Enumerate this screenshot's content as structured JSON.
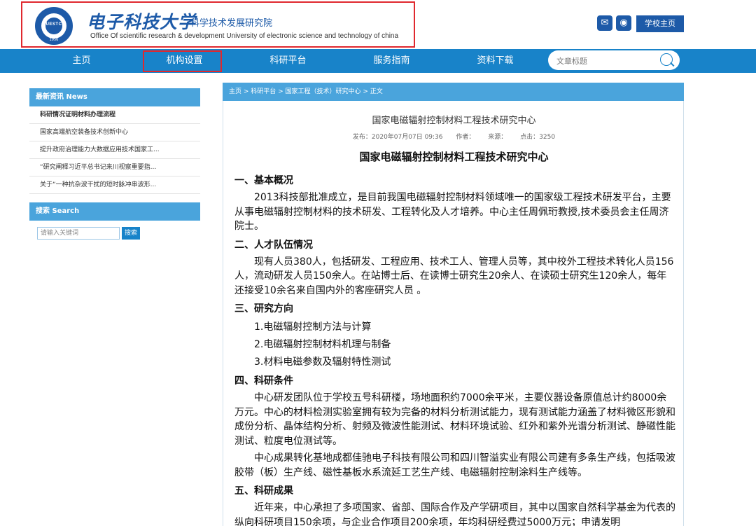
{
  "header": {
    "seal_text": "UESTC",
    "seal_year": "1956",
    "university_name": "电子科技大学",
    "institute_name": "科学技术发展研究院",
    "english_name": "Office Of scientific research & development University of electronic science and technology of china",
    "wechat_icon": "wechat-icon",
    "weibo_icon": "weibo-icon",
    "school_home_label": "学校主页"
  },
  "nav": {
    "items": [
      "主页",
      "机构设置",
      "科研平台",
      "服务指南",
      "资料下载"
    ],
    "search_placeholder": "文章标题"
  },
  "sidebar": {
    "news_header": "最新资讯   News",
    "news_items": [
      "科研情况证明材料办理流程",
      "国家高端航空装备技术创新中心",
      "提升政府治理能力大数据应用技术国家工...",
      "“研究阐释习近平总书记来川视察重要指...",
      "关于“一种抗杂波干扰的短时脉冲串波形..."
    ],
    "search_header": "搜索   Search",
    "search_placeholder": "请输入关键词",
    "search_button": "搜索"
  },
  "breadcrumb": "主页 > 科研平台 > 国家工程（技术）研究中心 > 正文",
  "article": {
    "title": "国家电磁辐射控制材料工程技术研究中心",
    "publish": "发布：2020年07月07日 09:36",
    "author": "作者：",
    "source": "来源：",
    "views": "点击：3250",
    "heading": "国家电磁辐射控制材料工程技术研究中心",
    "sections": [
      {
        "title": "一、基本概况",
        "paras": [
          "2013科技部批准成立，是目前我国电磁辐射控制材料领域唯一的国家级工程技术研发平台，主要从事电磁辐射控制材料的技术研发、工程转化及人才培养。中心主任周佩珩教授,技术委员会主任周济院士。"
        ]
      },
      {
        "title": "二、人才队伍情况",
        "paras": [
          "现有人员380人，包括研发、工程应用、技术工人、管理人员等，其中校外工程技术转化人员156人，流动研发人员150余人。在站博士后、在读博士研究生20余人、在读硕士研究生120余人，每年还接受10余名来自国内外的客座研究人员 。"
        ]
      },
      {
        "title": "三、研究方向",
        "items": [
          "1.电磁辐射控制方法与计算",
          "2.电磁辐射控制材料机理与制备",
          "3.材料电磁参数及辐射特性测试"
        ]
      },
      {
        "title": "四、科研条件",
        "paras": [
          "中心研发团队位于学校五号科研楼，场地面积约7000余平米，主要仪器设备原值总计约8000余万元。中心的材料检测实验室拥有较为完备的材料分析测试能力，现有测试能力涵盖了材料微区形貌和成份分析、晶体结构分析、射频及微波性能测试、材料环境试验、红外和紫外光谱分析测试、静磁性能测试、粒度电位测试等。",
          "中心成果转化基地成都佳驰电子科技有限公司和四川智溢实业有限公司建有多条生产线，包括吸波胶带（板）生产线、磁性基板水系流延工艺生产线、电磁辐射控制涂料生产线等。"
        ]
      },
      {
        "title": "五、科研成果",
        "paras": [
          "近年来，中心承担了多项国家、省部、国际合作及产学研项目，其中以国家自然科学基金为代表的纵向科研项目150余项，与企业合作项目200余项，年均科研经费过5000万元；申请发明"
        ]
      }
    ]
  },
  "colors": {
    "primary": "#1883c9",
    "brand": "#1d5aa8",
    "panel_header": "#4aa4dc",
    "highlight_border": "#e0282e"
  }
}
